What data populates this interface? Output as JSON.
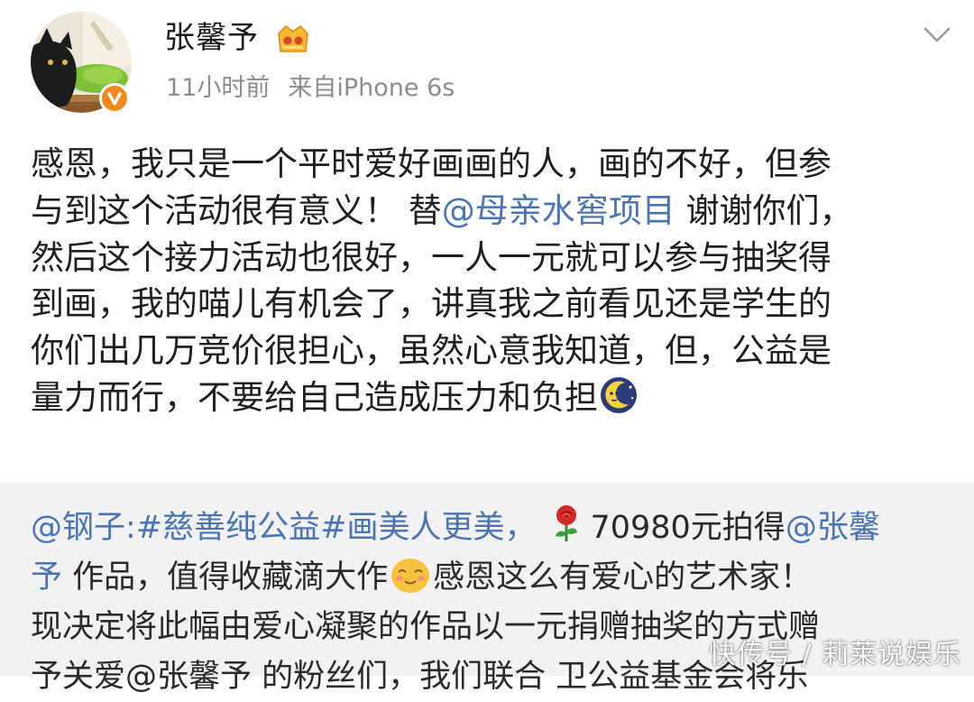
{
  "post": {
    "author": "张馨予",
    "time": "11小时前",
    "source": "来自iPhone 6s",
    "body": {
      "line1": "感恩，我只是一个平时爱好画画的人，画的不好，但参",
      "line2_prefix": "与到这个活动很有意义！ 替",
      "line2_mention": "@母亲水窖项目",
      "line2_suffix": " 谢谢你们，",
      "line3": "然后这个接力活动也很好，一人一元就可以参与抽奖得",
      "line4": "到画，我的喵儿有机会了，讲真我之前看见还是学生的",
      "line5": "你们出几万竞价很担心，虽然心意我知道，但，公益是",
      "line6": "量力而行，不要给自己造成压力和负担"
    }
  },
  "repost": {
    "line1_mention": "@钢子",
    "line1_text": ":#慈善纯公益#画美人更美，",
    "line1_price": "70980元拍得",
    "line1_mention2": "@张馨",
    "line2_mention": "予",
    "line2_text_a": " 作品，值得收藏滴大作",
    "line2_text_b": "感恩这么有爱心的艺术家！",
    "line3": "现决定将此幅由爱心凝聚的作品以一元捐赠抽奖的方式赠",
    "line4_partial": "予关爱@张馨予 的粉丝们，我们联合 卫公益基金会将乐"
  },
  "icons": {
    "vip": "vip-crown-icon",
    "verified": "verified-v-icon",
    "chevron": "chevron-down-icon",
    "moon": "sleeping-moon-emoji",
    "rose": "rose-emoji",
    "smile": "smile-emoji"
  },
  "colors": {
    "link": "#4a74b4",
    "meta": "#8c8c8c",
    "repost_bg": "#f2f2f2",
    "verified": "#f08a1c"
  },
  "watermark": "快传号 / 莉莱说娱乐"
}
